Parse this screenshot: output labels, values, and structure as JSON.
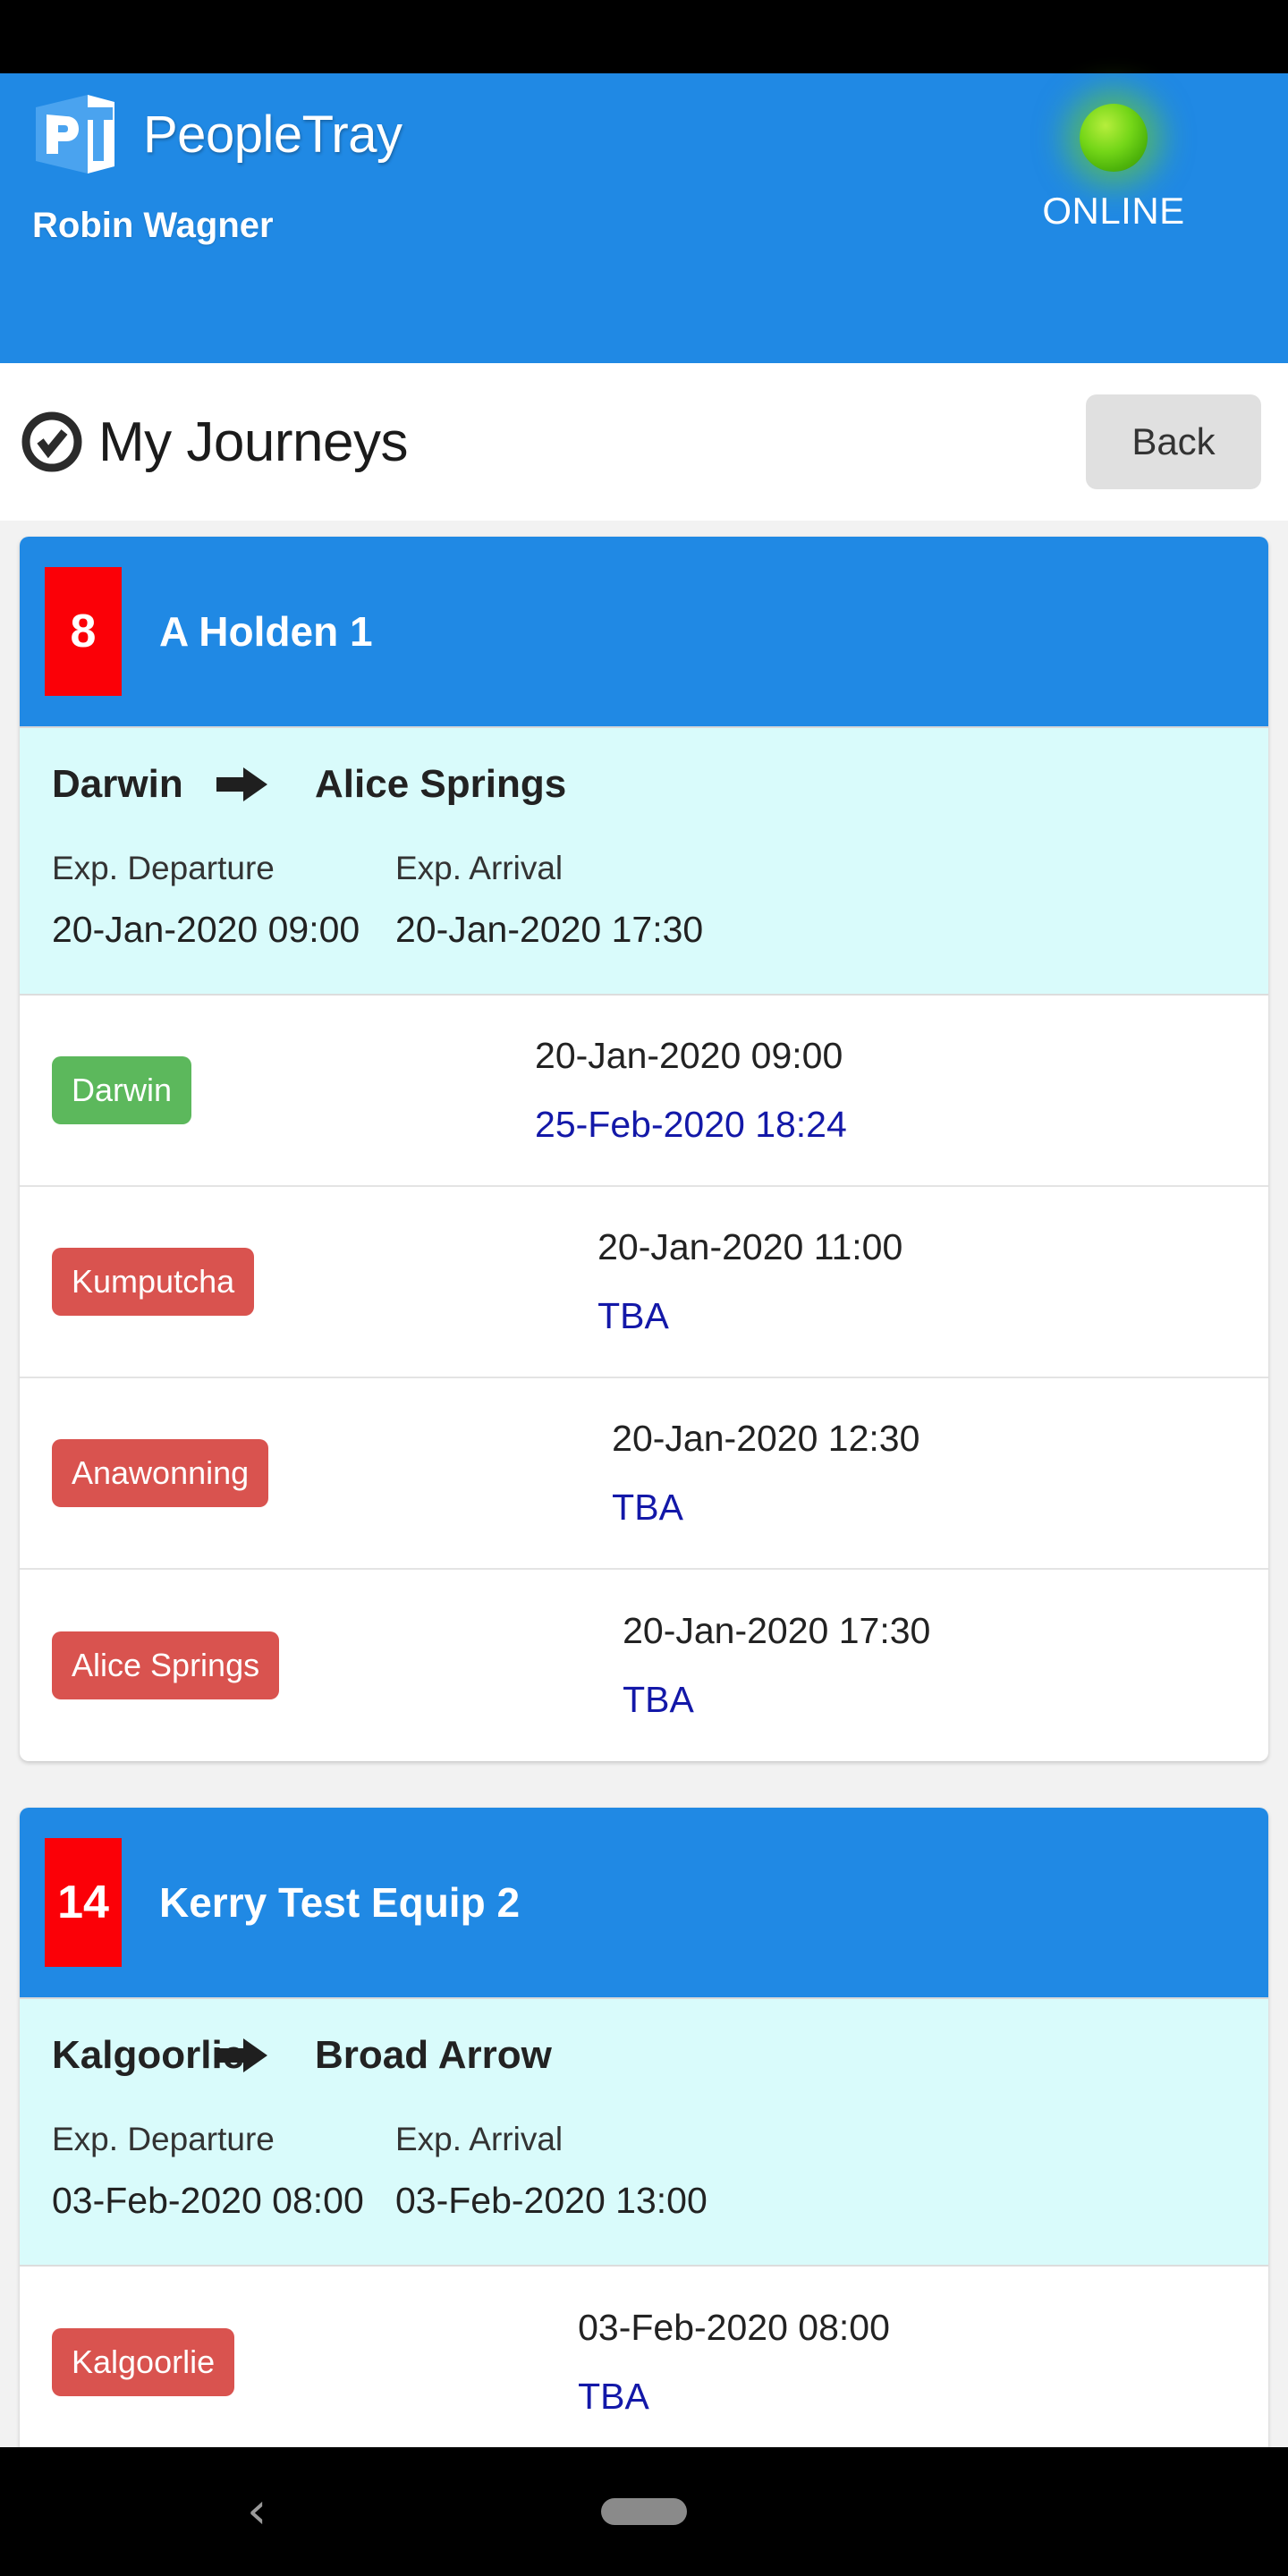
{
  "app": {
    "brand_name": "PeopleTray",
    "logo_letters": "PT",
    "connection_status": "ONLINE",
    "user_name": "Robin Wagner",
    "accent_blue": "#2089e4",
    "badge_red": "#fb0007",
    "status_green": "#74d618"
  },
  "titlebar": {
    "title": "My Journeys",
    "back_label": "Back",
    "icon": "check-circle-icon"
  },
  "journeys": [
    {
      "number": "8",
      "name": "A Holden 1",
      "route": {
        "from": "Darwin",
        "to": "Alice Springs",
        "departure_label": "Exp. Departure",
        "departure_value": "20-Jan-2020 09:00",
        "arrival_label": "Exp. Arrival",
        "arrival_value": "20-Jan-2020 17:30"
      },
      "stops": [
        {
          "name": "Darwin",
          "state": "green",
          "scheduled": "20-Jan-2020 09:00",
          "actual": "25-Feb-2020 18:24"
        },
        {
          "name": "Kumputcha",
          "state": "red",
          "scheduled": "20-Jan-2020 11:00",
          "actual": "TBA"
        },
        {
          "name": "Anawonning",
          "state": "red",
          "scheduled": "20-Jan-2020 12:30",
          "actual": "TBA"
        },
        {
          "name": "Alice Springs",
          "state": "red",
          "scheduled": "20-Jan-2020 17:30",
          "actual": "TBA"
        }
      ]
    },
    {
      "number": "14",
      "name": "Kerry Test Equip 2",
      "route": {
        "from": "Kalgoorlie",
        "to": "Broad Arrow",
        "departure_label": "Exp. Departure",
        "departure_value": "03-Feb-2020 08:00",
        "arrival_label": "Exp. Arrival",
        "arrival_value": "03-Feb-2020 13:00"
      },
      "stops": [
        {
          "name": "Kalgoorlie",
          "state": "red",
          "scheduled": "03-Feb-2020 08:00",
          "actual": "TBA"
        }
      ]
    }
  ],
  "navbar": {
    "back_glyph": "‹",
    "home_indicator": "home-pill"
  }
}
